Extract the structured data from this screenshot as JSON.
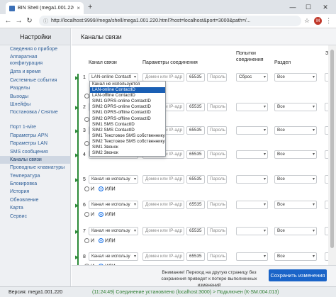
{
  "browser": {
    "tab_title": "BIN Shell (mega1.001.220)",
    "tab_close": "×",
    "new_tab": "+",
    "url": "http://localhost:9999//mega/shell/mega1.001.220.html?host=localhost&port=3000&path=/...",
    "profile_initial": "M",
    "win_minimize": "—",
    "win_maximize": "☐",
    "win_close": "✕",
    "back": "←",
    "forward": "→",
    "reload": "↻"
  },
  "sidebar": {
    "title": "Настройки",
    "items": [
      {
        "label": "Сведения о приборе"
      },
      {
        "label": "Аппаратная конфигурация"
      },
      {
        "label": "Дата и время"
      },
      {
        "label": "Системные события"
      },
      {
        "label": "Разделы"
      },
      {
        "label": "Выходы"
      },
      {
        "label": "Шлейфы"
      },
      {
        "label": "Постановка / Снятие"
      },
      {
        "label": "Порт 1-wire"
      },
      {
        "label": "Параметры APN"
      },
      {
        "label": "Параметры LAN"
      },
      {
        "label": "SMS сообщения"
      },
      {
        "label": "Каналы связи"
      },
      {
        "label": "Проводные клавиатуры"
      },
      {
        "label": "Температура"
      },
      {
        "label": "Блокировка"
      },
      {
        "label": "История"
      },
      {
        "label": "Обновление"
      },
      {
        "label": "Карта"
      },
      {
        "label": "Сервис"
      }
    ]
  },
  "main": {
    "title": "Каналы связи",
    "columns": {
      "channel": "Канал связи",
      "params": "Параметры соединения",
      "attempts": "Попытки соединения",
      "section": "Раздел",
      "extra": "Зв с"
    },
    "rows": [
      {
        "num": "1",
        "channel": "LAN-online ContactI",
        "host_ph": "Домен или IP-адр",
        "port": "65535",
        "pass_ph": "Пароль",
        "attempts": "Сброс",
        "section": "Все",
        "radio_and": "И",
        "radio_or": "ИЛИ"
      },
      {
        "num": "2",
        "channel": "Канал не используется",
        "host_ph": "Домен или IP-адр",
        "port": "65535",
        "pass_ph": "Пароль",
        "attempts": "",
        "section": "Все",
        "radio_and": "И",
        "radio_or": "ИЛИ"
      },
      {
        "num": "3",
        "channel": "Канал не используется",
        "host_ph": "Домен или IP-адр",
        "port": "65535",
        "pass_ph": "Пароль",
        "attempts": "",
        "section": "Все",
        "radio_and": "И",
        "radio_or": "ИЛИ"
      },
      {
        "num": "4",
        "channel": "Канал не используется",
        "host_ph": "Домен или IP-адр",
        "port": "65535",
        "pass_ph": "Пароль",
        "attempts": "",
        "section": "Все",
        "radio_and": "И",
        "radio_or": "ИЛИ"
      },
      {
        "num": "5",
        "channel": "Канал не использу",
        "host_ph": "Домен или IP-адр",
        "port": "65535",
        "pass_ph": "Пароль",
        "attempts": "",
        "section": "Все",
        "radio_and": "И",
        "radio_or": "ИЛИ"
      },
      {
        "num": "6",
        "channel": "Канал не использу",
        "host_ph": "Домен или IP-адр",
        "port": "65535",
        "pass_ph": "Пароль",
        "attempts": "",
        "section": "Все",
        "radio_and": "И",
        "radio_or": "ИЛИ"
      },
      {
        "num": "7",
        "channel": "Канал не использу",
        "host_ph": "Домен или IP-адр",
        "port": "65535",
        "pass_ph": "Пароль",
        "attempts": "",
        "section": "Все",
        "radio_and": "И",
        "radio_or": "ИЛИ"
      },
      {
        "num": "8",
        "channel": "Канал не использу",
        "host_ph": "Домен или IP-адр",
        "port": "65535",
        "pass_ph": "Пароль",
        "attempts": "",
        "section": "Все",
        "radio_and": "И",
        "radio_or": "ИЛИ"
      }
    ],
    "dropdown_options": [
      "Канал не используется",
      "LAN-online ContactID",
      "LAN-offline ContactID",
      "SIM1 GPRS-online ContactID",
      "SIM2 GPRS-online ContactID",
      "SIM1 GPRS-offline ContactID",
      "SIM2 GPRS-offline ContactID",
      "SIM1 SMS ContactID",
      "SIM2 SMS ContactID",
      "SIM1 Текстовое SMS собственнику",
      "SIM2 Текстовое SMS собственнику",
      "SIM1 Звонок",
      "SIM2 Звонок"
    ],
    "dropdown_selected_index": 1
  },
  "footer": {
    "warning": "Внимание! Переход на другую страницу без сохранения приведет к потере выполненных изменений",
    "save_label": "Сохранить изменения",
    "version": "Версия: mega1.001.220",
    "connection": "(11:24:49) Соединение установлено (localhost:3000) > Подключен (К-SM.004.013)"
  },
  "colors": {
    "accent": "#1a64c8",
    "link": "#2f5f98",
    "green": "#2e8b3a"
  }
}
